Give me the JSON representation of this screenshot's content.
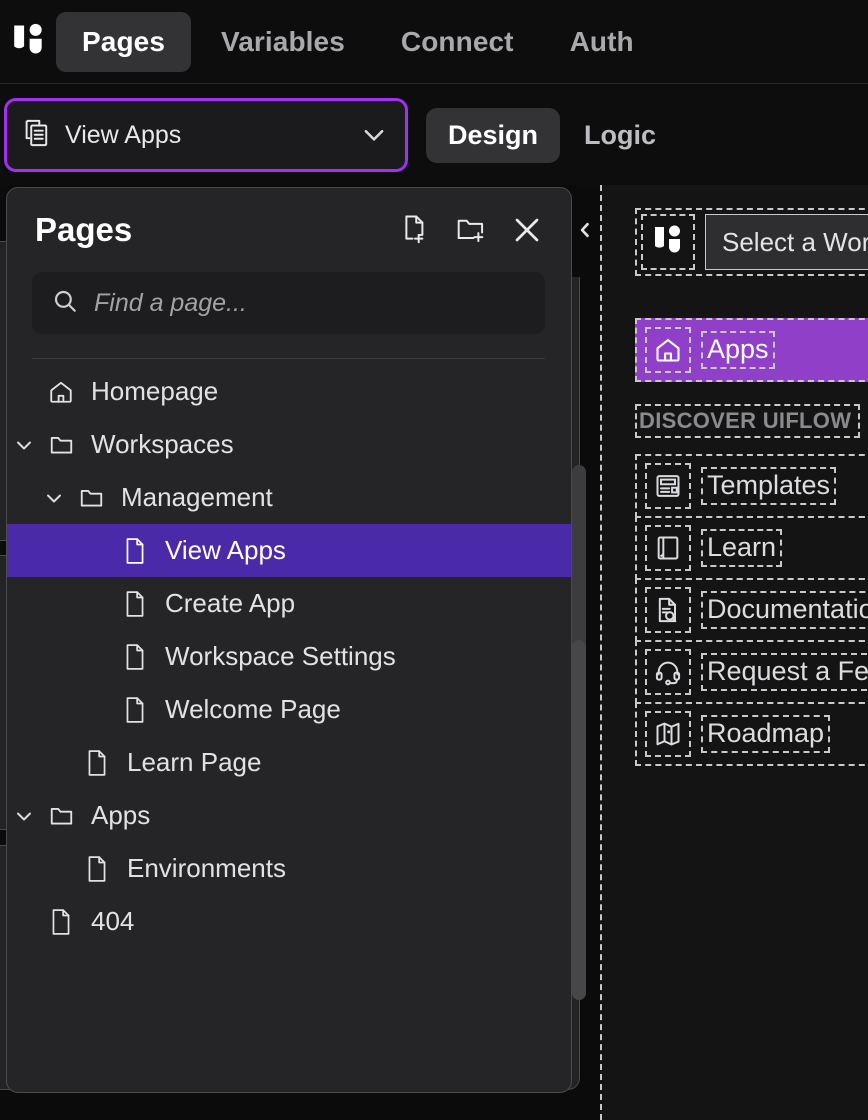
{
  "app": {
    "logo_icon": "uiflow-logo-icon",
    "nav_tabs": [
      {
        "label": "Pages",
        "active": true
      },
      {
        "label": "Variables",
        "active": false
      },
      {
        "label": "Connect",
        "active": false
      },
      {
        "label": "Auth",
        "active": false
      }
    ]
  },
  "subbar": {
    "page_selector": {
      "icon": "pages-stack-icon",
      "value": "View Apps",
      "chevron_icon": "chevron-down-icon",
      "highlight_color": "#a32ff0"
    },
    "mode_tabs": [
      {
        "label": "Design",
        "active": true
      },
      {
        "label": "Logic",
        "active": false
      }
    ]
  },
  "pages_panel": {
    "title": "Pages",
    "actions": [
      {
        "name": "new-page",
        "icon": "file-plus-icon"
      },
      {
        "name": "new-folder",
        "icon": "folder-plus-icon"
      },
      {
        "name": "close",
        "icon": "close-icon"
      }
    ],
    "search": {
      "value": "",
      "placeholder": "Find a page..."
    },
    "collapse_icon": "chevron-left-icon",
    "selected_color": "#4a2aa8",
    "tree": [
      {
        "label": "Homepage",
        "type": "page",
        "depth": 0,
        "chevron": "",
        "icon": "home-icon",
        "selected": false
      },
      {
        "label": "Workspaces",
        "type": "folder",
        "depth": 0,
        "chevron": "down",
        "icon": "folder-icon",
        "selected": false
      },
      {
        "label": "Management",
        "type": "folder",
        "depth": 1,
        "chevron": "down",
        "icon": "folder-icon",
        "selected": false
      },
      {
        "label": "View Apps",
        "type": "page",
        "depth": 2,
        "chevron": "",
        "icon": "file-icon",
        "selected": true
      },
      {
        "label": "Create App",
        "type": "page",
        "depth": 2,
        "chevron": "",
        "icon": "file-icon",
        "selected": false
      },
      {
        "label": "Workspace Settings",
        "type": "page",
        "depth": 2,
        "chevron": "",
        "icon": "file-icon",
        "selected": false
      },
      {
        "label": "Welcome Page",
        "type": "page",
        "depth": 2,
        "chevron": "",
        "icon": "file-icon",
        "selected": false
      },
      {
        "label": "Learn Page",
        "type": "page",
        "depth": 1,
        "chevron": "",
        "icon": "file-icon",
        "selected": false
      },
      {
        "label": "Apps",
        "type": "folder",
        "depth": 0,
        "chevron": "down",
        "icon": "folder-icon",
        "selected": false
      },
      {
        "label": "Environments",
        "type": "page",
        "depth": 1,
        "chevron": "",
        "icon": "file-icon",
        "selected": false
      },
      {
        "label": "404",
        "type": "page",
        "depth": 0,
        "chevron": "",
        "icon": "file-icon",
        "selected": false
      }
    ]
  },
  "canvas_preview": {
    "header": {
      "logo_icon": "uiflow-logo-icon",
      "workspace_select_value": "Select a Workspace"
    },
    "primary_nav": [
      {
        "label": "Apps",
        "icon": "home-icon",
        "selected": true,
        "color": "#9040c8"
      }
    ],
    "section_label": "DISCOVER UIFLOW",
    "secondary_nav": [
      {
        "label": "Templates",
        "icon": "templates-icon",
        "selected": false
      },
      {
        "label": "Learn",
        "icon": "book-icon",
        "selected": false
      },
      {
        "label": "Documentation",
        "icon": "doc-search-icon",
        "selected": false
      },
      {
        "label": "Request a Feature",
        "icon": "headset-icon",
        "selected": false
      },
      {
        "label": "Roadmap",
        "icon": "map-icon",
        "selected": false
      }
    ]
  }
}
